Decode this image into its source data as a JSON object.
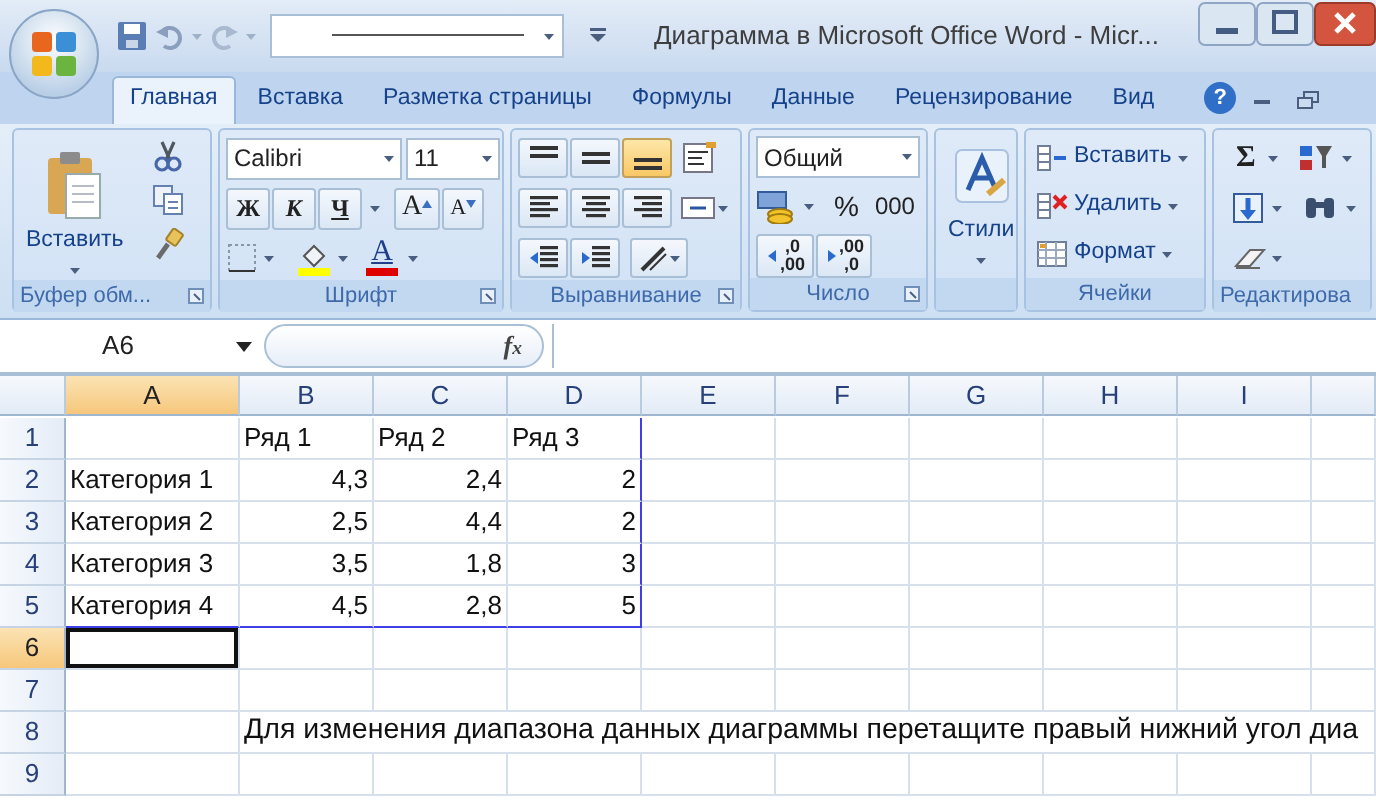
{
  "window": {
    "title": "Диаграмма в Microsoft Office Word - Micr..."
  },
  "tabs": [
    {
      "label": "Главная",
      "selected": true
    },
    {
      "label": "Вставка",
      "selected": false
    },
    {
      "label": "Разметка страницы",
      "selected": false
    },
    {
      "label": "Формулы",
      "selected": false
    },
    {
      "label": "Данные",
      "selected": false
    },
    {
      "label": "Рецензирование",
      "selected": false
    },
    {
      "label": "Вид",
      "selected": false
    }
  ],
  "help_button": "?",
  "ribbon": {
    "clipboard": {
      "label": "Буфер обм...",
      "paste": "Вставить"
    },
    "font": {
      "label": "Шрифт",
      "font_name": "Calibri",
      "font_size": "11",
      "bold": "Ж",
      "italic": "К",
      "underline": "Ч",
      "grow_font": "A",
      "shrink_font": "A",
      "font_color": "A"
    },
    "alignment": {
      "label": "Выравнивание",
      "vertical": [
        {
          "selected": false
        },
        {
          "selected": false
        },
        {
          "selected": true
        }
      ]
    },
    "number": {
      "label": "Число",
      "format": "Общий",
      "percent": "%",
      "thousands": "000",
      "increase_decimal": [
        ",0",
        ",00"
      ],
      "decrease_decimal": [
        ",00",
        ",0"
      ]
    },
    "styles": {
      "button": "Стили"
    },
    "cells": {
      "label": "Ячейки",
      "buttons": [
        "Вставить",
        "Удалить",
        "Формат"
      ]
    },
    "editing": {
      "label": "Редактирова",
      "sum": "Σ"
    }
  },
  "formula_bar": {
    "name_box": "A6",
    "function_label": "f$_{x}$"
  },
  "sheet": {
    "columns": [
      {
        "label": "A",
        "selected": true,
        "in_chart_range": true
      },
      {
        "label": "B",
        "selected": false,
        "in_chart_range": true
      },
      {
        "label": "C",
        "selected": false,
        "in_chart_range": true
      },
      {
        "label": "D",
        "selected": false,
        "in_chart_range": true
      },
      {
        "label": "E",
        "selected": false,
        "in_chart_range": false
      },
      {
        "label": "F",
        "selected": false,
        "in_chart_range": false
      },
      {
        "label": "G",
        "selected": false,
        "in_chart_range": false
      },
      {
        "label": "H",
        "selected": false,
        "in_chart_range": false
      },
      {
        "label": "I",
        "selected": false,
        "in_chart_range": false
      }
    ],
    "rows": [
      {
        "label": "1",
        "selected": false,
        "in_chart_range": true,
        "cells": [
          null,
          {
            "text": "Ряд 1",
            "kind": "text"
          },
          {
            "text": "Ряд 2",
            "kind": "text"
          },
          {
            "text": "Ряд 3",
            "kind": "text"
          }
        ]
      },
      {
        "label": "2",
        "selected": false,
        "in_chart_range": true,
        "cells": [
          {
            "text": "Категория 1",
            "kind": "text"
          },
          {
            "text": "4,3",
            "kind": "number"
          },
          {
            "text": "2,4",
            "kind": "number"
          },
          {
            "text": "2",
            "kind": "number"
          }
        ]
      },
      {
        "label": "3",
        "selected": false,
        "in_chart_range": true,
        "cells": [
          {
            "text": "Категория 2",
            "kind": "text"
          },
          {
            "text": "2,5",
            "kind": "number"
          },
          {
            "text": "4,4",
            "kind": "number"
          },
          {
            "text": "2",
            "kind": "number"
          }
        ]
      },
      {
        "label": "4",
        "selected": false,
        "in_chart_range": true,
        "cells": [
          {
            "text": "Категория 3",
            "kind": "text"
          },
          {
            "text": "3,5",
            "kind": "number"
          },
          {
            "text": "1,8",
            "kind": "number"
          },
          {
            "text": "3",
            "kind": "number"
          }
        ]
      },
      {
        "label": "5",
        "selected": false,
        "in_chart_range": true,
        "cells": [
          {
            "text": "Категория 4",
            "kind": "text"
          },
          {
            "text": "4,5",
            "kind": "number"
          },
          {
            "text": "2,8",
            "kind": "number"
          },
          {
            "text": "5",
            "kind": "number"
          }
        ]
      },
      {
        "label": "6",
        "selected": true,
        "in_chart_range": false
      },
      {
        "label": "7",
        "selected": false,
        "in_chart_range": false
      },
      {
        "label": "8",
        "selected": false,
        "in_chart_range": false,
        "cells": [
          null,
          {
            "text": "Для изменения диапазона данных диаграммы перетащите правый нижний угол диа",
            "kind": "text"
          }
        ]
      },
      {
        "label": "9",
        "selected": false,
        "in_chart_range": false
      }
    ]
  }
}
